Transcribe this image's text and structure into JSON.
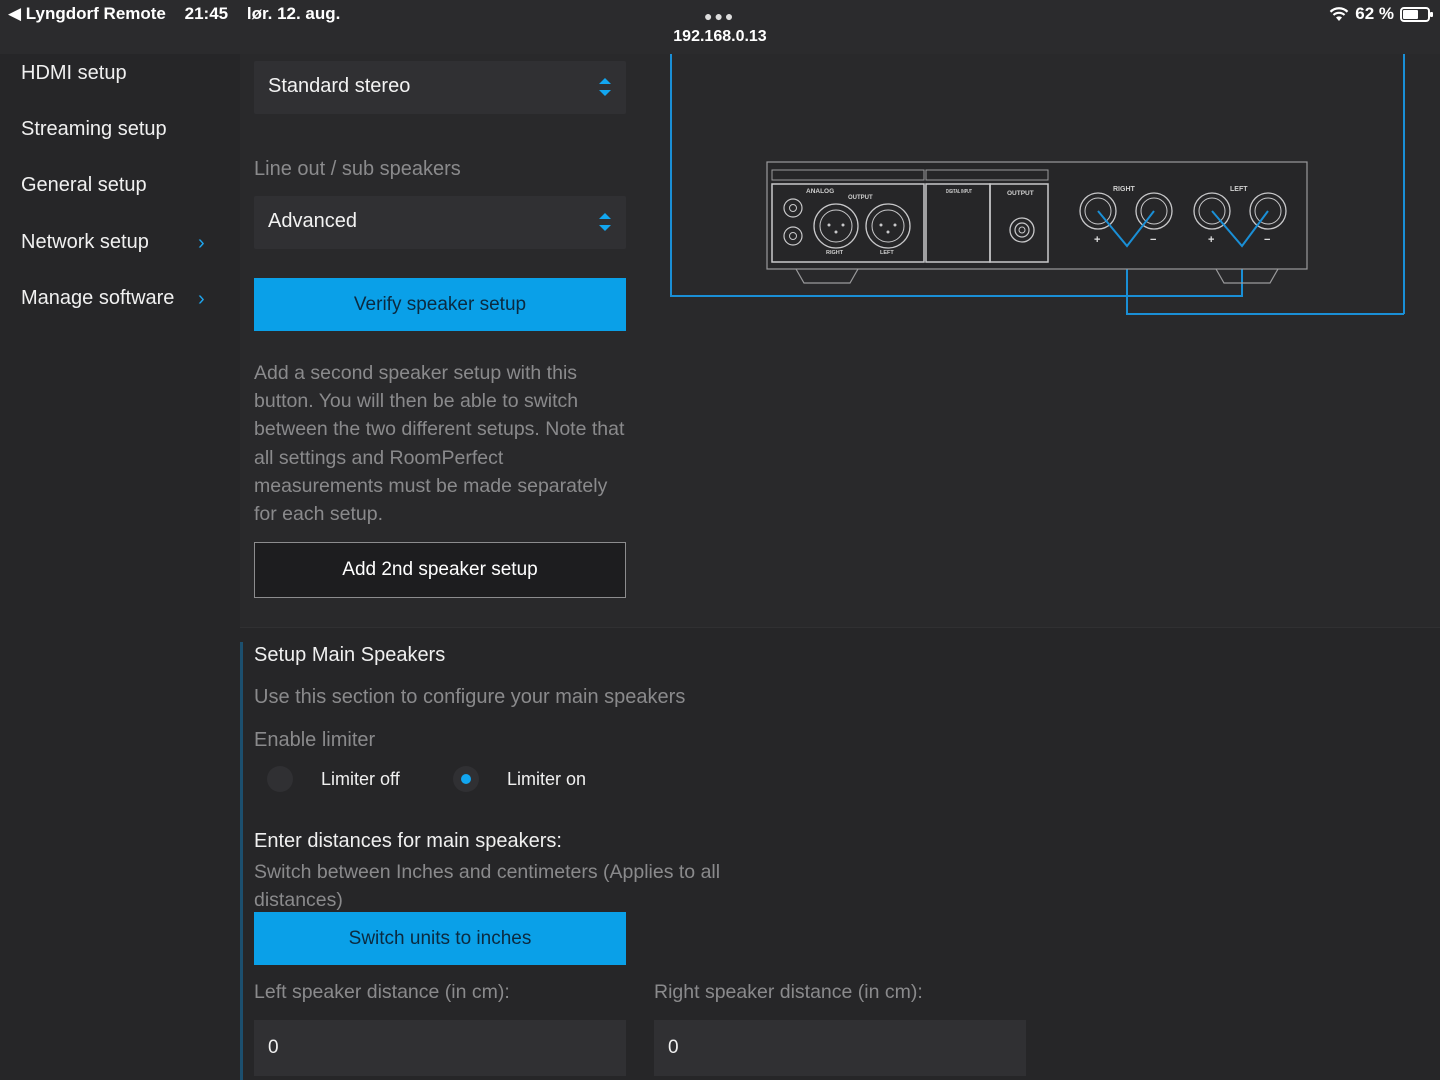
{
  "status_bar": {
    "back_app": "◀ Lyngdorf Remote",
    "time": "21:45",
    "date": "lør. 12. aug.",
    "url": "192.168.0.13",
    "battery": "62 %",
    "battery_level": 0.62
  },
  "sidebar": {
    "items": [
      {
        "label": "HDMI setup"
      },
      {
        "label": "Streaming setup"
      },
      {
        "label": "General setup"
      },
      {
        "label": "Network setup"
      },
      {
        "label": "Manage software"
      }
    ]
  },
  "speaker_config": {
    "main_select_value": "Standard stereo",
    "line_out_label": "Line out / sub speakers",
    "line_out_select_value": "Advanced",
    "verify_button": "Verify speaker setup",
    "description": "Add a second speaker setup with this button. You will then be able to switch between the two different setups. Note that all settings and RoomPerfect measurements must be made separately for each setup.",
    "add_second_button": "Add 2nd speaker setup"
  },
  "diagram_labels": {
    "analog": "ANALOG",
    "output": "OUTPUT",
    "right_small": "RIGHT",
    "left_small": "LEFT",
    "digital_input": "DIGITAL INPUT",
    "output2": "OUTPUT",
    "right": "RIGHT",
    "left": "LEFT",
    "plus": "+",
    "minus": "−"
  },
  "main_speakers": {
    "title": "Setup Main Speakers",
    "subtitle": "Use this section to configure your main speakers",
    "limiter_label": "Enable limiter",
    "limiter_off": "Limiter off",
    "limiter_on": "Limiter on",
    "distances_heading": "Enter distances for main speakers:",
    "distances_hint": "Switch between Inches and centimeters (Applies to all distances)",
    "switch_units_button": "Switch units to inches",
    "left_distance_label": "Left speaker distance (in cm):",
    "right_distance_label": "Right speaker distance (in cm):",
    "left_distance_value": "0",
    "right_distance_value": "0"
  },
  "colors": {
    "accent": "#0aa0e8",
    "background": "#29292b"
  }
}
